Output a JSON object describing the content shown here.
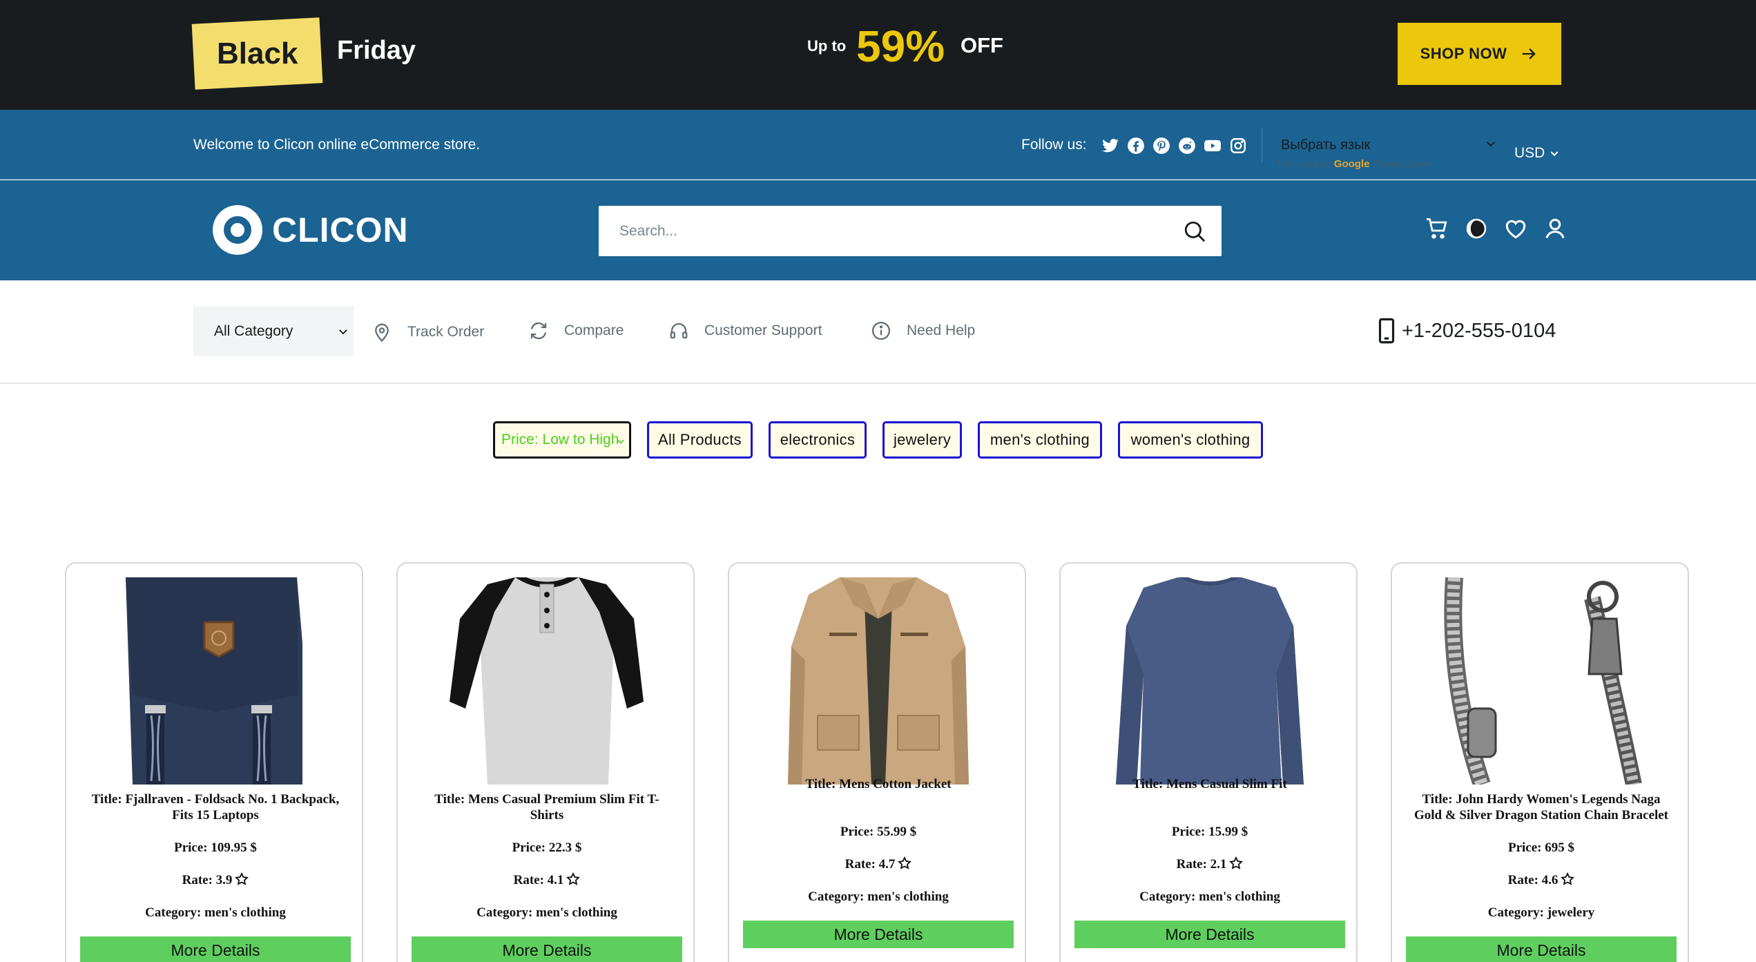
{
  "promo": {
    "badge": "Black",
    "friday": "Friday",
    "up_to": "Up to",
    "percent": "59%",
    "off": "OFF",
    "shop_now": "SHOP NOW"
  },
  "topbar": {
    "welcome": "Welcome to Clicon online eCommerce store.",
    "follow_us": "Follow us:",
    "socials": [
      "twitter-icon",
      "facebook-icon",
      "pinterest-icon",
      "reddit-icon",
      "youtube-icon",
      "instagram-icon"
    ],
    "language": "Выбрать язык",
    "translate_prefix": "Технологии",
    "translate_google": "Google",
    "translate_suffix": "Переводчик",
    "currency": "USD"
  },
  "header": {
    "logo": "CLICON",
    "search_placeholder": "Search..."
  },
  "nav": {
    "category": "All Category",
    "track_order": "Track Order",
    "compare": "Compare",
    "customer_support": "Customer Support",
    "need_help": "Need Help",
    "phone": "+1-202-555-0104"
  },
  "filters": {
    "sort": "Price: Low to High",
    "buttons": [
      "All Products",
      "electronics",
      "jewelery",
      "men's clothing",
      "women's clothing"
    ]
  },
  "products": [
    {
      "title_line1": "Title: Fjallraven - Foldsack No. 1 Backpack,",
      "title_line2": "Fits 15 Laptops",
      "price": "Price: 109.95 $",
      "rate": "Rate: 3.9",
      "category": "Category: men's clothing",
      "button": "More Details"
    },
    {
      "title_line1": "Title: Mens Casual Premium Slim Fit T-",
      "title_line2": "Shirts",
      "price": "Price: 22.3 $",
      "rate": "Rate: 4.1",
      "category": "Category: men's clothing",
      "button": "More Details"
    },
    {
      "title_line1": "Title: Mens Cotton Jacket",
      "title_line2": "",
      "price": "Price: 55.99 $",
      "rate": "Rate: 4.7",
      "category": "Category: men's clothing",
      "button": "More Details"
    },
    {
      "title_line1": "Title: Mens Casual Slim Fit",
      "title_line2": "",
      "price": "Price: 15.99 $",
      "rate": "Rate: 2.1",
      "category": "Category: men's clothing",
      "button": "More Details"
    },
    {
      "title_line1": "Title: John Hardy Women's Legends Naga",
      "title_line2": "Gold & Silver Dragon Station Chain Bracelet",
      "price": "Price: 695 $",
      "rate": "Rate: 4.6",
      "category": "Category: jewelery",
      "button": "More Details"
    }
  ],
  "colors": {
    "promo_bg": "#191c1f",
    "primary_blue": "#1b6392",
    "accent_yellow": "#ebc80c",
    "button_green": "#5ecf5f",
    "filter_border": "#1a12d4"
  }
}
